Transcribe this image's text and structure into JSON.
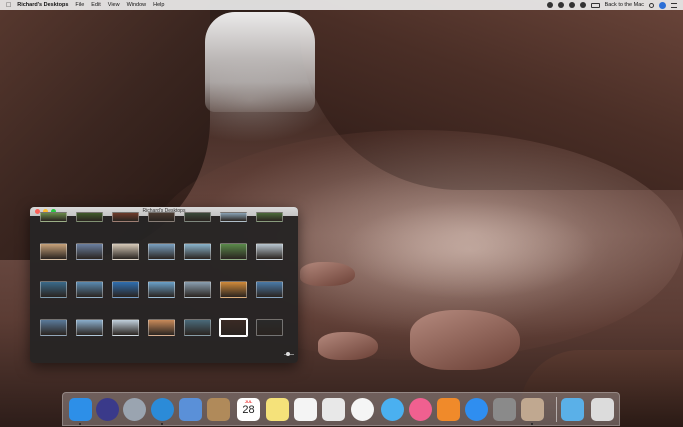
{
  "menubar": {
    "apple": "",
    "app_name": "Richard's Desktops",
    "items": [
      "File",
      "Edit",
      "View",
      "Window",
      "Help"
    ],
    "right": {
      "back_to_mac": "Back to the Mac"
    }
  },
  "window": {
    "title": "Richard's Desktops",
    "thumbnails": [
      [
        "#6a8a4a",
        "#3f5a2a",
        "#6e3a2a",
        "#4a3a30",
        "#3a4a3a",
        "#8aa3b5",
        "#4a6a3a"
      ],
      [
        "#c7a27a",
        "#6b7fa0",
        "#d6c9b8",
        "#7aa0c0",
        "#8ab4cc",
        "#5a8a4a",
        "#b9c6d0"
      ],
      [
        "#3a6a8a",
        "#5a8ab0",
        "#2f6fb0",
        "#6aa0c8",
        "#8a9fb0",
        "#d08a3a",
        "#4a7aa8"
      ],
      [
        "#5a7a9a",
        "#8aaecc",
        "#c0cfdc",
        "#c88a5a",
        "#4a6a7a",
        "#3a2a24",
        "#2a2a2a"
      ]
    ],
    "selected": [
      3,
      5
    ]
  },
  "dock": {
    "icons": [
      {
        "name": "finder-icon",
        "color": "#2d8fe8"
      },
      {
        "name": "siri-icon",
        "color": "#3a3a8a"
      },
      {
        "name": "launchpad-icon",
        "color": "#9aa4b0"
      },
      {
        "name": "safari-icon",
        "color": "#2b8bd8"
      },
      {
        "name": "mail-icon",
        "color": "#5a90d8"
      },
      {
        "name": "contacts-icon",
        "color": "#b08a5a"
      },
      {
        "name": "calendar-icon",
        "color": "#ffffff"
      },
      {
        "name": "notes-icon",
        "color": "#f5e27a"
      },
      {
        "name": "reminders-icon",
        "color": "#f4f4f4"
      },
      {
        "name": "keynote-icon",
        "color": "#e8e8e8"
      },
      {
        "name": "photos-icon",
        "color": "#f5f5f5"
      },
      {
        "name": "messages-icon",
        "color": "#4ab0f0"
      },
      {
        "name": "itunes-icon",
        "color": "#f06090"
      },
      {
        "name": "ibooks-icon",
        "color": "#f08a2a"
      },
      {
        "name": "app-store-icon",
        "color": "#2f8ef0"
      },
      {
        "name": "system-preferences-icon",
        "color": "#8a8a8a"
      },
      {
        "name": "preview-icon",
        "color": "#c0a890"
      },
      {
        "name": "downloads-folder-icon",
        "color": "#5ab0e8"
      },
      {
        "name": "trash-icon",
        "color": "#dcdcdc"
      }
    ],
    "calendar": {
      "month": "JUL",
      "day": "28"
    }
  }
}
